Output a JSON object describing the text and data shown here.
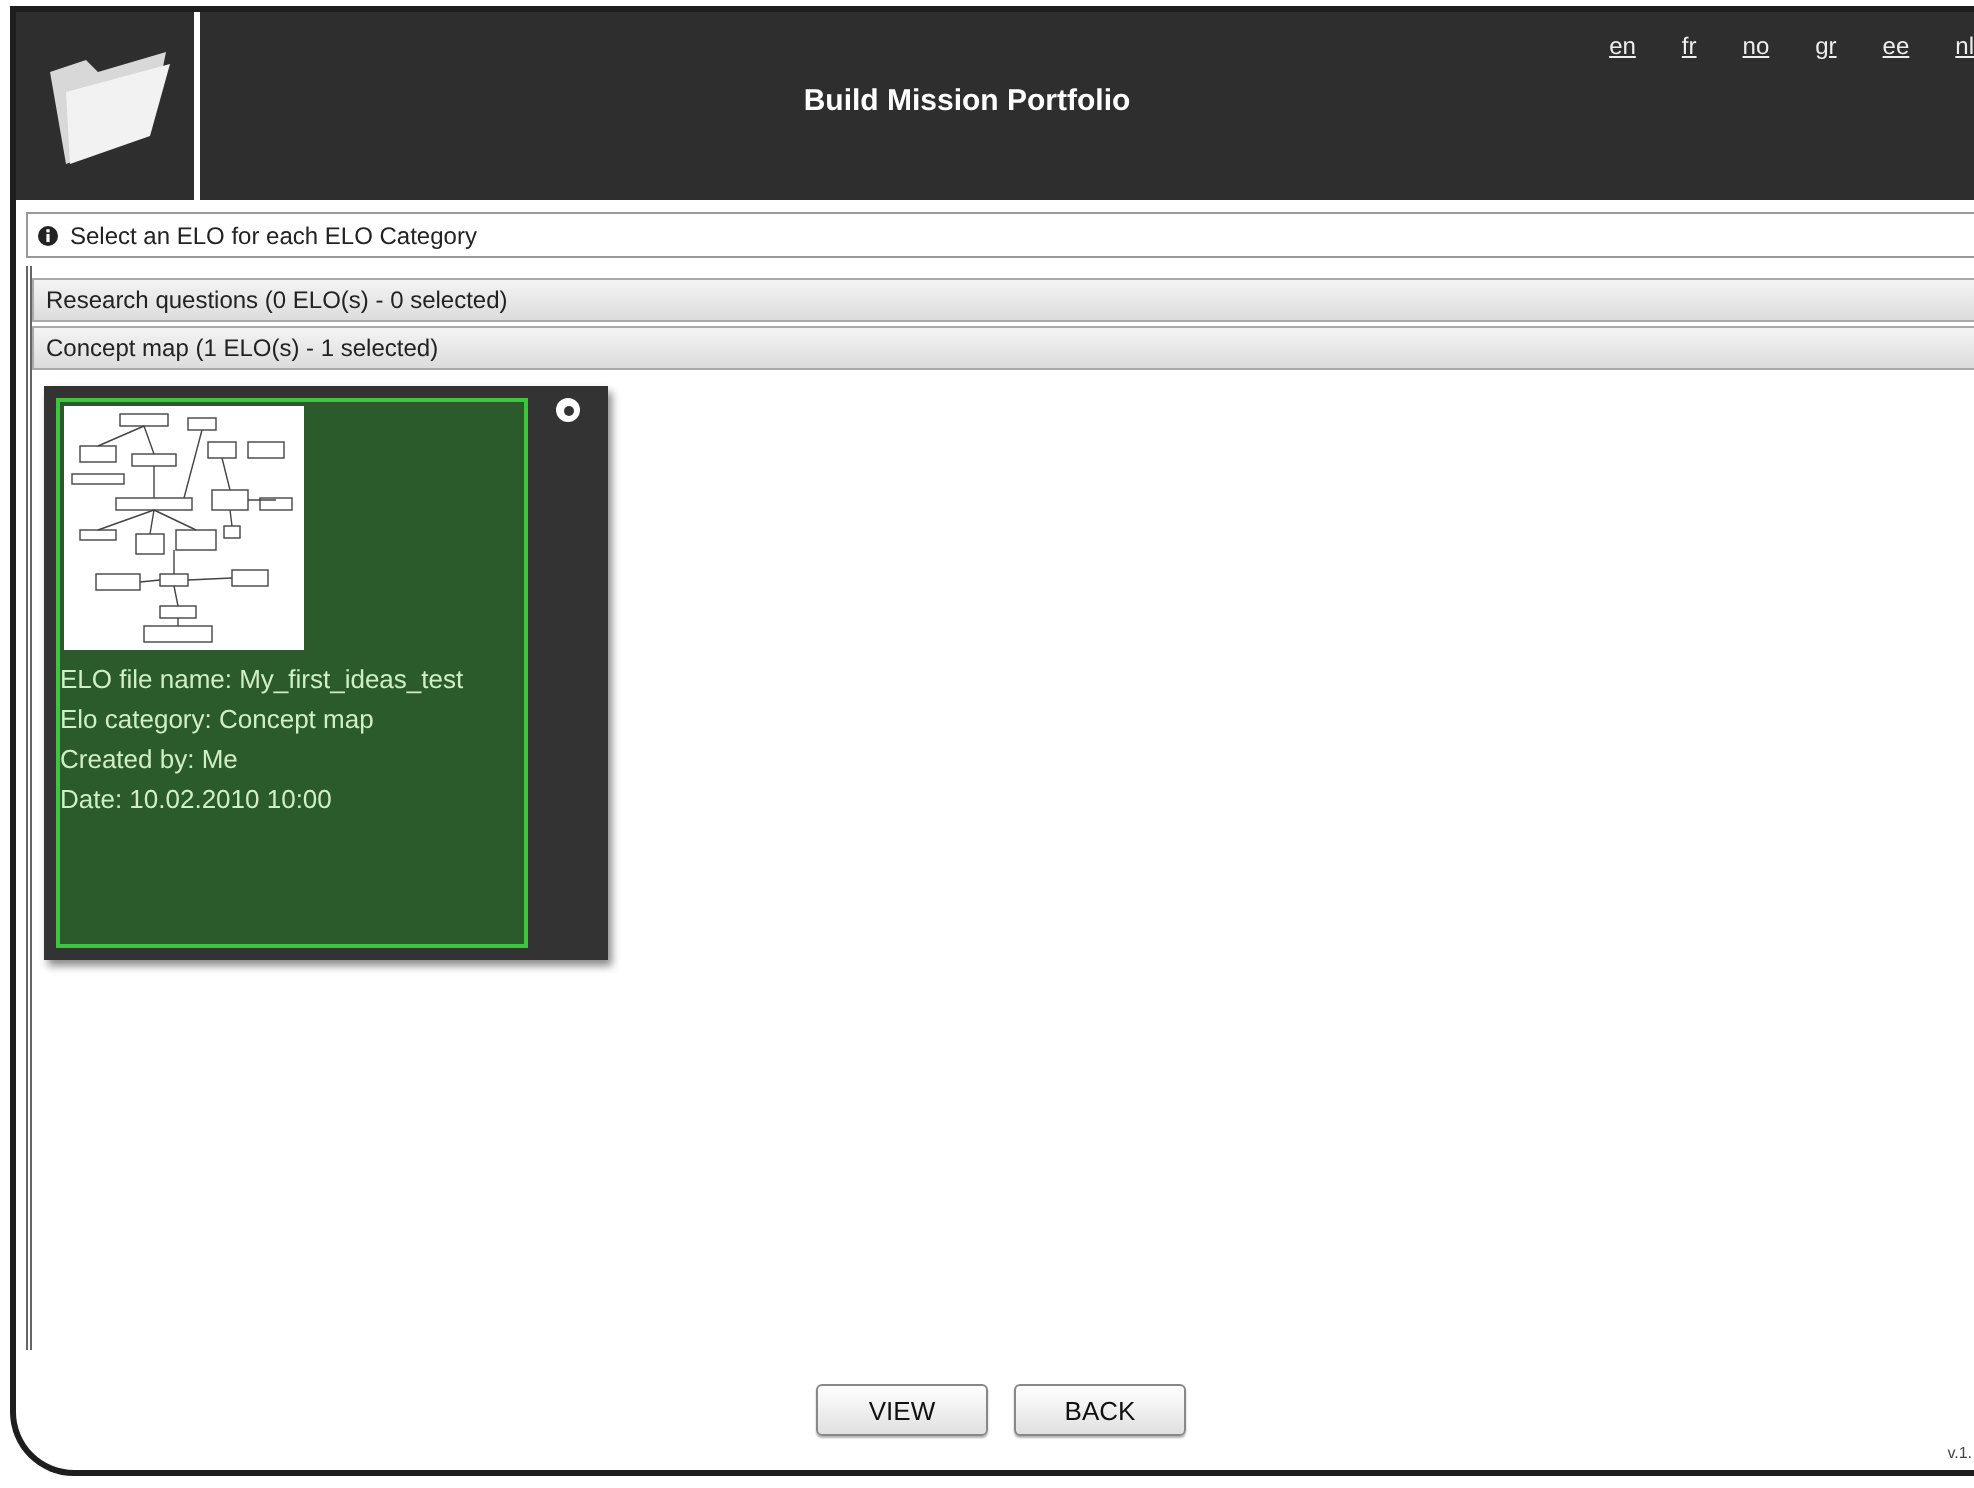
{
  "header": {
    "title": "Build Mission Portfolio",
    "languages": [
      "en",
      "fr",
      "no",
      "gr",
      "ee",
      "nl"
    ]
  },
  "info": "Select an ELO for each ELO Category",
  "categories": [
    {
      "label": "Research questions (0 ELO(s) - 0 selected)"
    },
    {
      "label": "Concept map (1 ELO(s) - 1 selected)",
      "elos": [
        {
          "selected": true,
          "lines": [
            "ELO file name: My_first_ideas_test",
            "Elo category: Concept map",
            "Created by: Me",
            "Date: 10.02.2010 10:00"
          ]
        }
      ]
    }
  ],
  "buttons": [
    "VIEW",
    "BACK"
  ],
  "version": "v.1."
}
